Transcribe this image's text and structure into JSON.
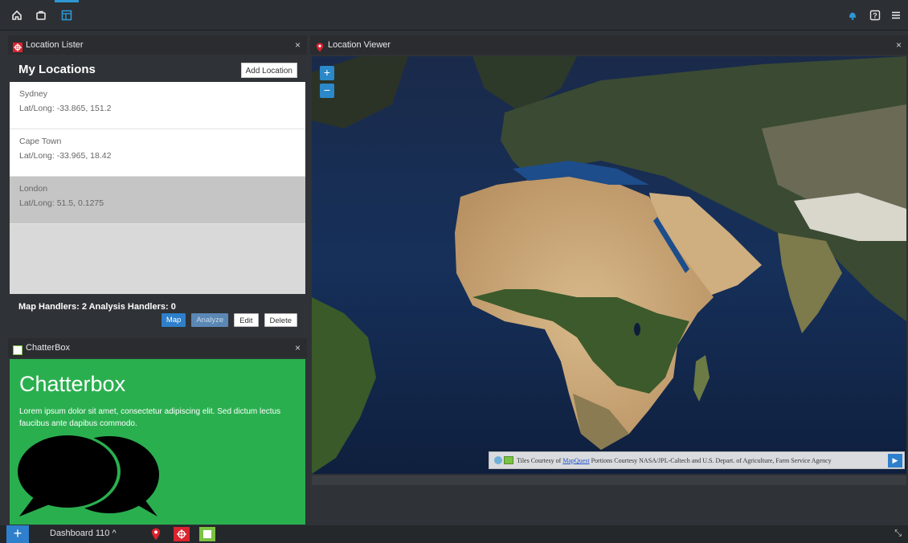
{
  "topbar": {
    "icons": [
      "home-icon",
      "briefcase-icon",
      "dashboard-icon",
      "notification-icon",
      "help-icon",
      "menu-icon"
    ]
  },
  "lister": {
    "header_title": "Location Lister",
    "close": "×",
    "title": "My Locations",
    "add_button": "Add Location",
    "locations": [
      {
        "name": "Sydney",
        "coords": "Lat/Long: -33.865, 151.2"
      },
      {
        "name": "Cape Town",
        "coords": "Lat/Long: -33.965, 18.42"
      },
      {
        "name": "London",
        "coords": "Lat/Long: 51.5, 0.1275"
      }
    ],
    "selected_index": 2,
    "handlers_text": "Map Handlers: 2 Analysis Handlers: 0",
    "buttons": {
      "map": "Map",
      "analyze": "Analyze",
      "edit": "Edit",
      "delete": "Delete"
    }
  },
  "chatter": {
    "header_title": "ChatterBox",
    "close": "×",
    "title": "Chatterbox",
    "body": "Lorem ipsum dolor sit amet, consectetur adipiscing elit. Sed dictum lectus faucibus ante dapibus commodo."
  },
  "viewer": {
    "header_title": "Location Viewer",
    "close": "×",
    "zoom_in": "+",
    "zoom_out": "−",
    "attribution_prefix": "Tiles Courtesy of ",
    "attribution_link": "MapQuest",
    "attribution_suffix": " Portions Courtesy NASA/JPL-Caltech and U.S. Depart. of Agriculture, Farm Service Agency",
    "attribution_toggle": "▶"
  },
  "bottombar": {
    "add": "+",
    "dashboard_label": "Dashboard 110 ^",
    "resize": "⤡"
  },
  "colors": {
    "accent": "#2e7fcc",
    "chatter_green": "#2aaf4f",
    "pin_red": "#d9232e"
  }
}
